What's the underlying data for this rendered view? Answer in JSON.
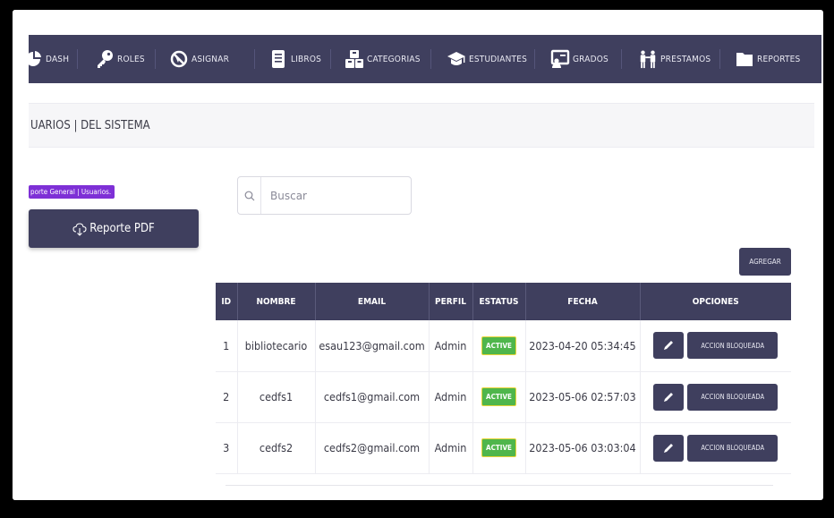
{
  "nav": {
    "items": [
      {
        "label": "DASH",
        "icon": "pie-chart-icon"
      },
      {
        "label": "ROLES",
        "icon": "key-icon"
      },
      {
        "label": "ASIGNAR",
        "icon": "no-access-icon"
      },
      {
        "label": "LIBROS",
        "icon": "book-icon"
      },
      {
        "label": "CATEGORIAS",
        "icon": "boxes-icon"
      },
      {
        "label": "ESTUDIANTES",
        "icon": "graduation-cap-icon"
      },
      {
        "label": "GRADOS",
        "icon": "presentation-icon"
      },
      {
        "label": "PRESTAMOS",
        "icon": "people-icon"
      },
      {
        "label": "REPORTES",
        "icon": "folder-icon"
      }
    ]
  },
  "header": {
    "title": "UARIOS | DEL SISTEMA"
  },
  "left": {
    "badge": "porte General | Usuarios.",
    "pdf_button": "Reporte PDF"
  },
  "search": {
    "placeholder": "Buscar"
  },
  "add_button": "AGREGAR",
  "table": {
    "headers": [
      "ID",
      "NOMBRE",
      "EMAIL",
      "PERFIL",
      "ESTATUS",
      "FECHA",
      "OPCIONES"
    ],
    "rows": [
      {
        "id": "1",
        "nombre": "bibliotecario",
        "email": "esau123@gmail.com",
        "perfil": "Admin",
        "estatus": "ACTIVE",
        "fecha": "2023-04-20 05:34:45",
        "accion": "ACCION BLOQUEADA"
      },
      {
        "id": "2",
        "nombre": "cedfs1",
        "email": "cedfs1@gmail.com",
        "perfil": "Admin",
        "estatus": "ACTIVE",
        "fecha": "2023-05-06 02:57:03",
        "accion": "ACCION BLOQUEADA"
      },
      {
        "id": "3",
        "nombre": "cedfs2",
        "email": "cedfs2@gmail.com",
        "perfil": "Admin",
        "estatus": "ACTIVE",
        "fecha": "2023-05-06 03:03:04",
        "accion": "ACCION BLOQUEADA"
      }
    ]
  },
  "colors": {
    "nav": "#3f3f5e",
    "badge": "#7e30d6",
    "status": "#4fb64b"
  }
}
